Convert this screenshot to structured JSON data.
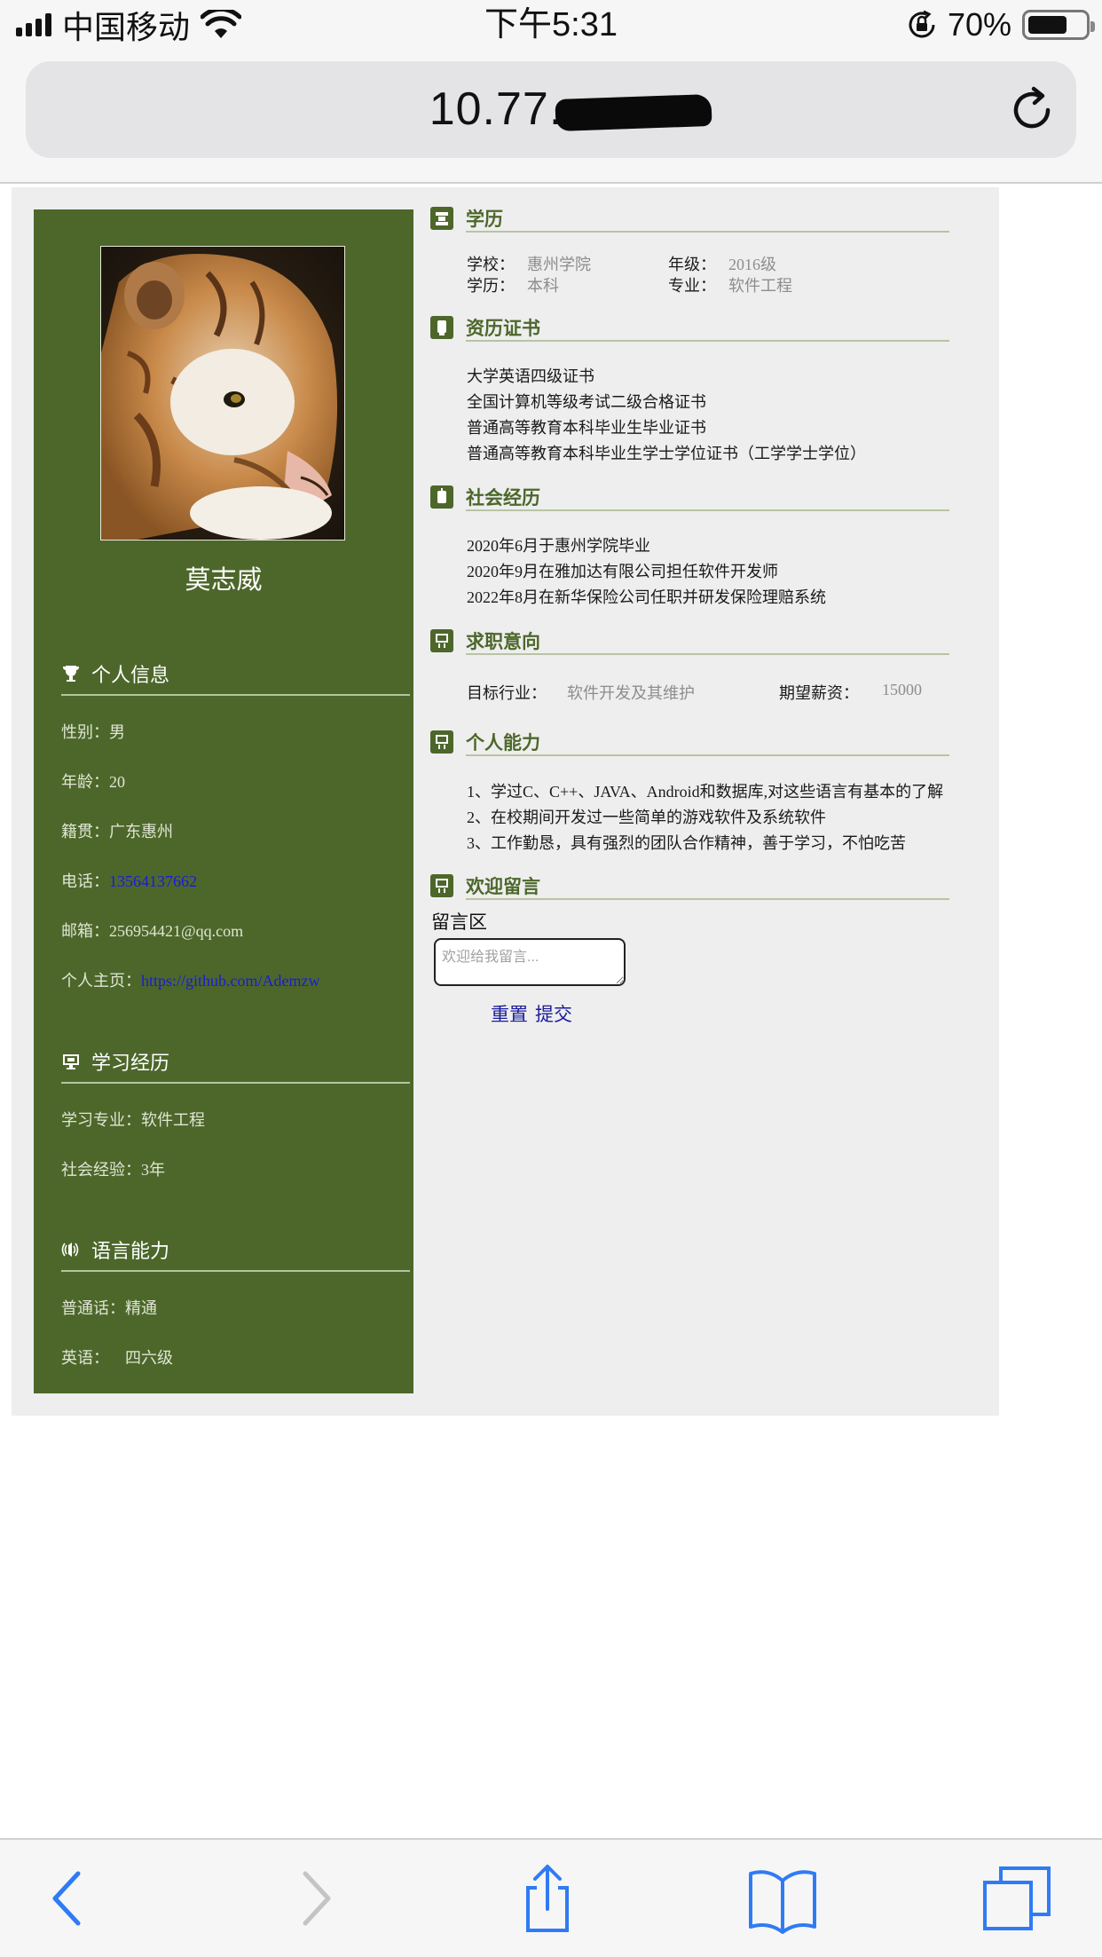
{
  "status_bar": {
    "carrier": "中国移动",
    "time": "下午5:31",
    "battery_percent": "70%",
    "battery_level": 0.7
  },
  "browser": {
    "url": "10.77."
  },
  "profile": {
    "name": "莫志威",
    "personal_info": {
      "title": "个人信息",
      "rows": [
        {
          "label": "性别：",
          "value": "男"
        },
        {
          "label": "年龄：",
          "value": "20"
        },
        {
          "label": "籍贯：",
          "value": "广东惠州"
        },
        {
          "label": "电话：",
          "value": "13564137662"
        },
        {
          "label": "邮箱：",
          "value": "256954421@qq.com"
        },
        {
          "label": "个人主页：",
          "value": "https://github.com/Ademzw"
        }
      ]
    },
    "study": {
      "title": "学习经历",
      "rows": [
        {
          "label": "学习专业：",
          "value": "软件工程"
        },
        {
          "label": "社会经验：",
          "value": "3年"
        }
      ]
    },
    "language": {
      "title": "语言能力",
      "rows": [
        {
          "label": "普通话：",
          "value": "精通"
        },
        {
          "label": "英语：",
          "value": "四六级"
        }
      ]
    }
  },
  "education": {
    "title": "学历",
    "school_label": "学校：",
    "school": "惠州学院",
    "grade_label": "年级：",
    "grade": "2016级",
    "degree_label": "学历：",
    "degree": "本科",
    "major_label": "专业：",
    "major": "软件工程"
  },
  "certificates": {
    "title": "资历证书",
    "items": [
      "大学英语四级证书",
      "全国计算机等级考试二级合格证书",
      "普通高等教育本科毕业生毕业证书",
      "普通高等教育本科毕业生学士学位证书（工学学士学位）"
    ]
  },
  "experience": {
    "title": "社会经历",
    "items": [
      "2020年6月于惠州学院毕业",
      "2020年9月在雅加达有限公司担任软件开发师",
      "2022年8月在新华保险公司任职并研发保险理赔系统"
    ]
  },
  "intention": {
    "title": "求职意向",
    "industry_label": "目标行业：",
    "industry": "软件开发及其维护",
    "salary_label": "期望薪资：",
    "salary": "15000"
  },
  "skills": {
    "title": "个人能力",
    "items": [
      "1、学过C、C++、JAVA、Android和数据库,对这些语言有基本的了解",
      "2、在校期间开发过一些简单的游戏软件及系统软件",
      "3、工作勤恳，具有强烈的团队合作精神，善于学习，不怕吃苦"
    ]
  },
  "guestbook": {
    "title": "欢迎留言",
    "area_label": "留言区",
    "placeholder": "欢迎给我留言...",
    "reset_label": "重置",
    "submit_label": "提交"
  },
  "colors": {
    "sidebar_green": "#4d672b",
    "page_bg": "#eeeeee",
    "link_blue": "#1a1adb",
    "ios_blue": "#2f7bf5"
  },
  "icons": [
    "signal-icon",
    "wifi-icon",
    "rotation-lock-icon",
    "battery-icon",
    "reload-icon",
    "back-icon",
    "forward-icon",
    "share-icon",
    "bookmarks-icon",
    "tabs-icon"
  ]
}
